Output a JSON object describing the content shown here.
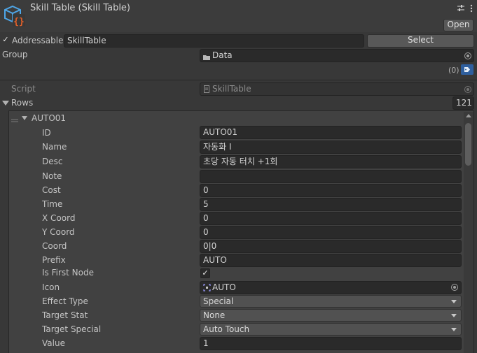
{
  "header": {
    "title": "Skill Table (Skill Table)",
    "open_label": "Open",
    "settings_icon": "sliders-icon",
    "menu_icon": "kebab-menu-icon"
  },
  "addressable": {
    "checked": true,
    "label": "Addressable",
    "value": "SkillTable",
    "select_label": "Select"
  },
  "group": {
    "label": "Group",
    "value": "Data",
    "count": "(0)"
  },
  "script": {
    "label": "Script",
    "value": "SkillTable"
  },
  "rows": {
    "label": "Rows",
    "count": "121",
    "element": {
      "name": "AUTO01",
      "fields": {
        "id": {
          "label": "ID",
          "value": "AUTO01"
        },
        "name": {
          "label": "Name",
          "value": "자동화 I"
        },
        "desc": {
          "label": "Desc",
          "value": "초당 자동 터치 +1회"
        },
        "note": {
          "label": "Note",
          "value": ""
        },
        "cost": {
          "label": "Cost",
          "value": "0"
        },
        "time": {
          "label": "Time",
          "value": "5"
        },
        "x_coord": {
          "label": "X Coord",
          "value": "0"
        },
        "y_coord": {
          "label": "Y Coord",
          "value": "0"
        },
        "coord": {
          "label": "Coord",
          "value": "0|0"
        },
        "prefix": {
          "label": "Prefix",
          "value": "AUTO"
        },
        "is_first_node": {
          "label": "Is First Node",
          "checked": true
        },
        "icon": {
          "label": "Icon",
          "value": "AUTO"
        },
        "effect_type": {
          "label": "Effect Type",
          "value": "Special"
        },
        "target_stat": {
          "label": "Target Stat",
          "value": "None"
        },
        "target_special": {
          "label": "Target Special",
          "value": "Auto Touch"
        },
        "value": {
          "label": "Value",
          "value": "1"
        }
      }
    }
  },
  "colors": {
    "background": "#383838",
    "field": "#2a2a2a",
    "accent_blue": "#2f5f9e",
    "script_icon_orange": "#e0602a",
    "script_icon_blue": "#4ea6e8"
  }
}
